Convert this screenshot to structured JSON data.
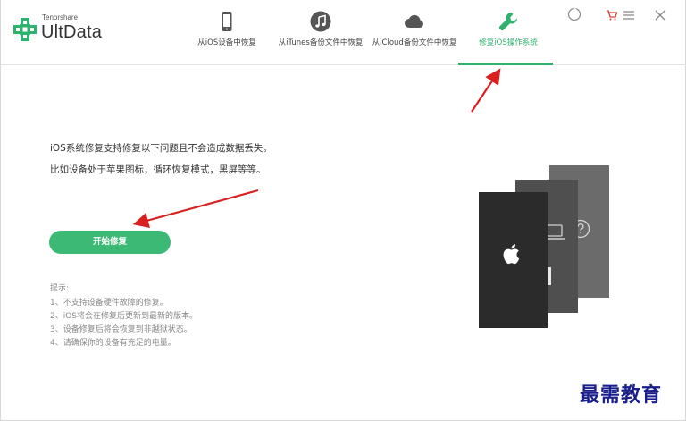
{
  "app": {
    "brand_small": "Tenorshare",
    "brand_name": "UltData"
  },
  "tabs": [
    {
      "label": "从iOS设备中恢复",
      "icon": "iphone-icon",
      "active": false
    },
    {
      "label": "从iTunes备份文件中恢复",
      "icon": "music-note-icon",
      "active": false
    },
    {
      "label": "从iCloud备份文件中恢复",
      "icon": "cloud-icon",
      "active": false
    },
    {
      "label": "修复iOS操作系统",
      "icon": "wrench-icon",
      "active": true
    }
  ],
  "window_controls": {
    "icons": [
      "refresh-icon",
      "cart-icon",
      "menu-icon",
      "close-icon"
    ]
  },
  "main": {
    "description_line1": "iOS系统修复支持修复以下问题且不会造成数据丢失。",
    "description_line2": "比如设备处于苹果图标，循环恢复模式，黑屏等等。",
    "start_button": "开始修复",
    "tips_title": "提示:",
    "tips": [
      "1、不支持设备硬件故障的修复。",
      "2、iOS将会在修复后更新到最新的版本。",
      "3、设备修复后将会恢复到非越狱状态。",
      "4、请确保你的设备有充足的电量。"
    ]
  },
  "illustration": {
    "icons": [
      "apple-logo-icon",
      "laptop-icon",
      "question-icon"
    ]
  },
  "watermark": "最需教育",
  "colors": {
    "accent": "#2db36e",
    "button": "#3cba75",
    "arrow": "#d92020",
    "watermark": "#1a1f8c"
  }
}
